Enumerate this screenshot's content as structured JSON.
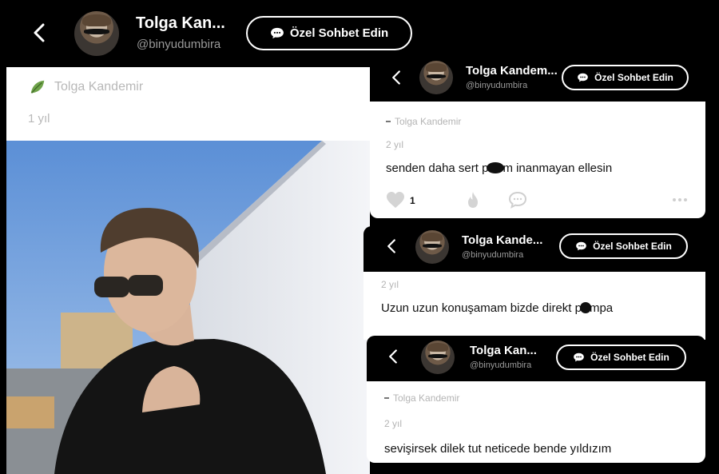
{
  "main_header": {
    "name": "Tolga Kan...",
    "handle": "@binyudumbira",
    "chat_label": "Özel Sohbet Edin"
  },
  "left_post": {
    "author": "Tolga Kandemir",
    "time": "1 yıl"
  },
  "card1": {
    "name": "Tolga Kandem...",
    "handle": "@binyudumbira",
    "chat_label": "Özel Sohbet Edin",
    "author": "Tolga Kandemir",
    "time": "2 yıl",
    "text_before": "senden daha sert p",
    "text_after": "m inanmayan ellesin",
    "like_count": "1"
  },
  "card2": {
    "name": "Tolga Kande...",
    "handle": "@binyudumbira",
    "chat_label": "Özel Sohbet Edin",
    "time": "2 yıl",
    "text_before": "Uzun uzun konuşamam bizde direkt p",
    "text_after": "mpa"
  },
  "card3": {
    "name": "Tolga Kan...",
    "handle": "@binyudumbira",
    "chat_label": "Özel Sohbet Edin",
    "author": "Tolga Kandemir",
    "time": "2 yıl",
    "text": "sevişirsek dilek tut neticede bende yıldızım"
  },
  "icons": {
    "back": "chevron-left-icon",
    "chat": "speech-bubble-icon",
    "leaf": "leaf-icon",
    "like": "heart-icon",
    "fire": "fire-icon",
    "comment": "comment-icon",
    "more": "ellipsis-icon"
  }
}
